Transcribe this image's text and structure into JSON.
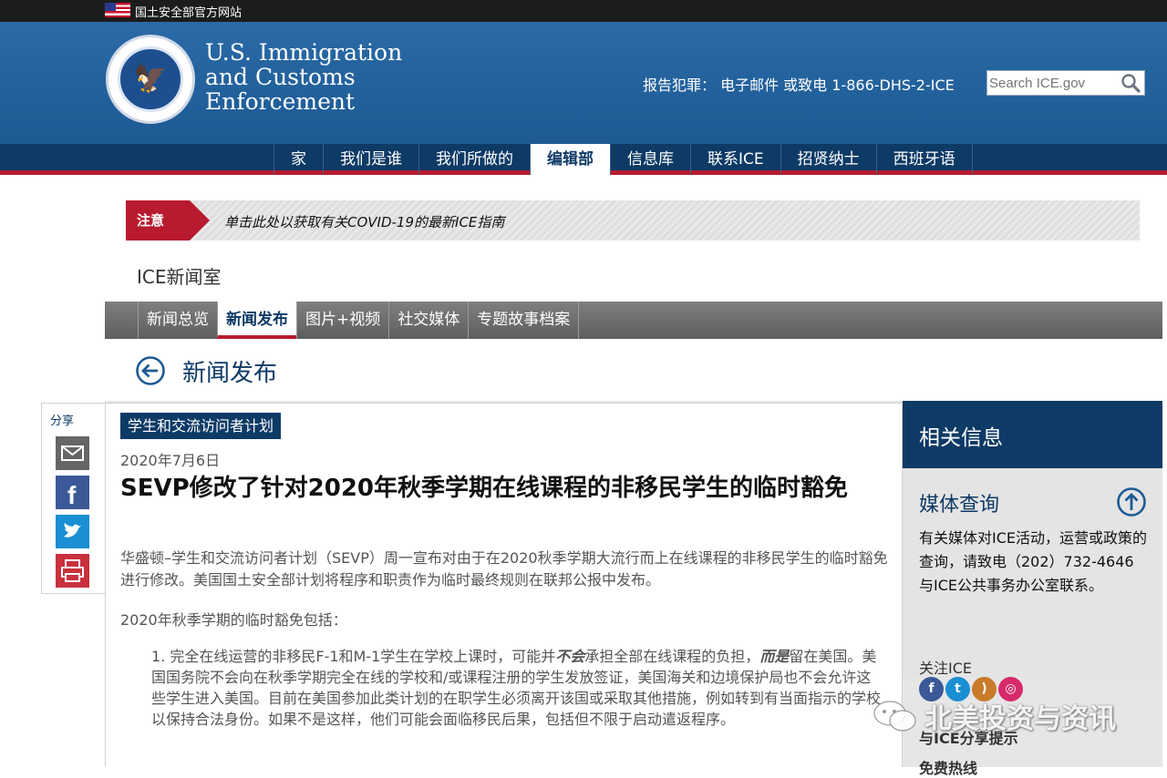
{
  "topbar": {
    "official_site": "国土安全部官方网站"
  },
  "header": {
    "agency_line1": "U.S. Immigration",
    "agency_line2": "and Customs",
    "agency_line3": "Enforcement",
    "report_text": "报告犯罪： 电子邮件 或致电 1-866-DHS-2-ICE",
    "search_placeholder": "Search ICE.gov"
  },
  "nav": {
    "items": [
      {
        "label": "家"
      },
      {
        "label": "我们是谁"
      },
      {
        "label": "我们所做的"
      },
      {
        "label": "编辑部"
      },
      {
        "label": "信息库"
      },
      {
        "label": "联系ICE"
      },
      {
        "label": "招贤纳士"
      },
      {
        "label": "西班牙语"
      }
    ],
    "active_index": 3
  },
  "alert": {
    "tag": "注意",
    "message": "单击此处以获取有关COVID-19的最新ICE指南"
  },
  "newsroom": {
    "label": "ICE新闻室"
  },
  "subnav": {
    "items": [
      {
        "label": "新闻总览"
      },
      {
        "label": "新闻发布"
      },
      {
        "label": "图片+视频"
      },
      {
        "label": "社交媒体"
      },
      {
        "label": "专题故事档案"
      }
    ],
    "active_index": 1
  },
  "page": {
    "title": "新闻发布"
  },
  "share": {
    "label": "分享"
  },
  "article": {
    "category": "学生和交流访问者计划",
    "date": "2020年7月6日",
    "headline": "SEVP修改了针对2020年秋季学期在线课程的非移民学生的临时豁免",
    "paragraph1": "华盛顿–学生和交流访问者计划（SEVP）周一宣布对由于在2020秋季学期大流行而上在线课程的非移民学生的临时豁免进行修改。美国国土安全部计划将程序和职责作为临时最终规则在联邦公报中发布。",
    "paragraph2": "2020年秋季学期的临时豁免包括：",
    "list": [
      {
        "number": "1.",
        "part1": "完全在线运营的非移民F-1和M-1学生在学校上课时，可能并",
        "em1": "不会",
        "part2": "承担全部在线课程的负担，",
        "em2": "而是",
        "part3": "留在美国。美国国务院不会向在秋季学期完全在线的学校和/或课程注册的学生发放签证，美国海关和边境保护局也不会允许这些学生进入美国。目前在美国参加此类计划的在职学生必须离开该国或采取其他措施，例如转到有当面指示的学校以保持合法身份。如果不是这样，他们可能会面临移民后果，包括但不限于启动遣返程序。"
      }
    ]
  },
  "sidebar": {
    "heading": "相关信息",
    "media_title": "媒体查询",
    "media_text": "有关媒体对ICE活动，运营或政策的查询，请致电（202）732-4646与ICE公共事务办公室联系。",
    "follow_label": "关注ICE",
    "tips_label": "与ICE分享提示",
    "hotline_label": "免费热线"
  },
  "watermark": {
    "text": "北美投资与资讯"
  },
  "colors": {
    "navy": "#0e3a66",
    "red": "#b81b2f",
    "header_blue": "#2a6aa6"
  }
}
